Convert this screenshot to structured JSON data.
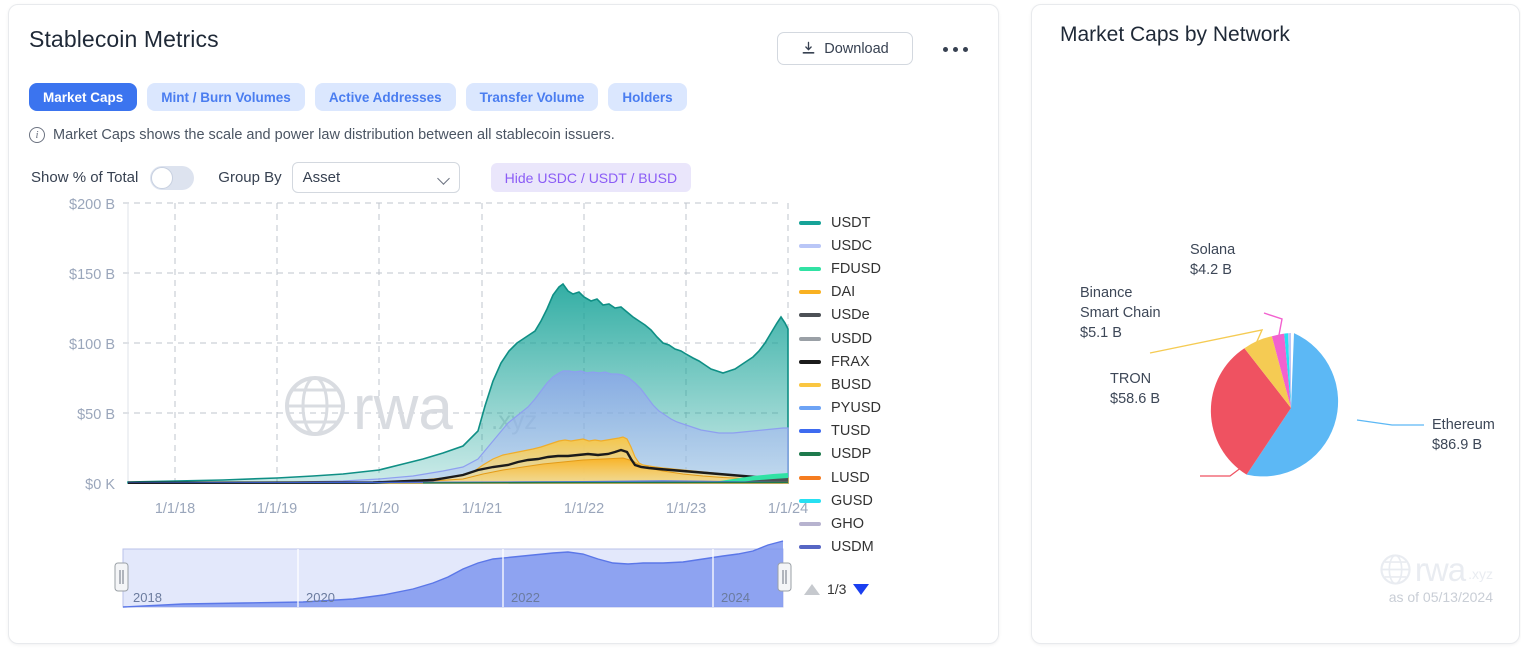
{
  "left_panel": {
    "title": "Stablecoin Metrics",
    "download_label": "Download",
    "download_icon": "download-icon",
    "more_icon": "more-horizontal-icon",
    "tabs": [
      {
        "label": "Market Caps",
        "active": true
      },
      {
        "label": "Mint / Burn Volumes",
        "active": false
      },
      {
        "label": "Active Addresses",
        "active": false
      },
      {
        "label": "Transfer Volume",
        "active": false
      },
      {
        "label": "Holders",
        "active": false
      }
    ],
    "info_icon": "info-icon",
    "info_text": "Market Caps shows the scale and power law distribution between all stablecoin issuers.",
    "controls": {
      "show_pct_label": "Show % of Total",
      "show_pct_value": "off",
      "group_by_label": "Group By",
      "group_by_value": "Asset",
      "group_by_options": [
        "Asset"
      ],
      "hide_button_label": "Hide USDC / USDT / BUSD"
    },
    "pager": {
      "text": "1/3",
      "up_icon": "triangle-up-icon",
      "down_icon": "triangle-down-icon"
    },
    "watermark": "rwa.xyz"
  },
  "right_panel": {
    "title": "Market Caps by Network",
    "watermark_main": "rwa",
    "watermark_sub": ".xyz",
    "as_of": "as of 05/13/2024"
  },
  "chart_data": [
    {
      "type": "area",
      "title": "Stablecoin Market Caps",
      "xlabel": "",
      "ylabel": "",
      "ylim": [
        0,
        200
      ],
      "yticks": [
        "$0 K",
        "$50 B",
        "$100 B",
        "$150 B",
        "$200 B"
      ],
      "xticks": [
        "1/1/18",
        "1/1/19",
        "1/1/20",
        "1/1/21",
        "1/1/22",
        "1/1/23",
        "1/1/24"
      ],
      "grid": true,
      "legend_position": "right",
      "stacked": true,
      "series": [
        {
          "name": "USDT",
          "color": "#17a398"
        },
        {
          "name": "USDC",
          "color": "#b9c6f7"
        },
        {
          "name": "FDUSD",
          "color": "#31e2a4"
        },
        {
          "name": "DAI",
          "color": "#f9b122"
        },
        {
          "name": "USDe",
          "color": "#4d5156"
        },
        {
          "name": "USDD",
          "color": "#9aa0a6"
        },
        {
          "name": "FRAX",
          "color": "#1b1b1b"
        },
        {
          "name": "BUSD",
          "color": "#fac641"
        },
        {
          "name": "PYUSD",
          "color": "#6da3f5"
        },
        {
          "name": "TUSD",
          "color": "#3e6bf0"
        },
        {
          "name": "USDP",
          "color": "#1e7a4d"
        },
        {
          "name": "LUSD",
          "color": "#f57c20"
        },
        {
          "name": "GUSD",
          "color": "#27e0f2"
        },
        {
          "name": "GHO",
          "color": "#b7b3cf"
        },
        {
          "name": "USDM",
          "color": "#5666c4"
        }
      ],
      "navigator": {
        "ticks": [
          "2018",
          "2020",
          "2022",
          "2024"
        ],
        "range": "full"
      }
    },
    {
      "type": "pie",
      "title": "Market Caps by Network",
      "labels": [
        "Ethereum",
        "TRON",
        "Binance Smart Chain",
        "Solana"
      ],
      "values": [
        86.9,
        58.6,
        5.1,
        4.2
      ],
      "value_labels": [
        "$86.9 B",
        "$58.6 B",
        "$5.1 B",
        "$4.2 B"
      ],
      "colors": [
        "#5cb8f5",
        "#ef5261",
        "#f5cb53",
        "#f261cf"
      ],
      "unit": "B USD"
    }
  ]
}
